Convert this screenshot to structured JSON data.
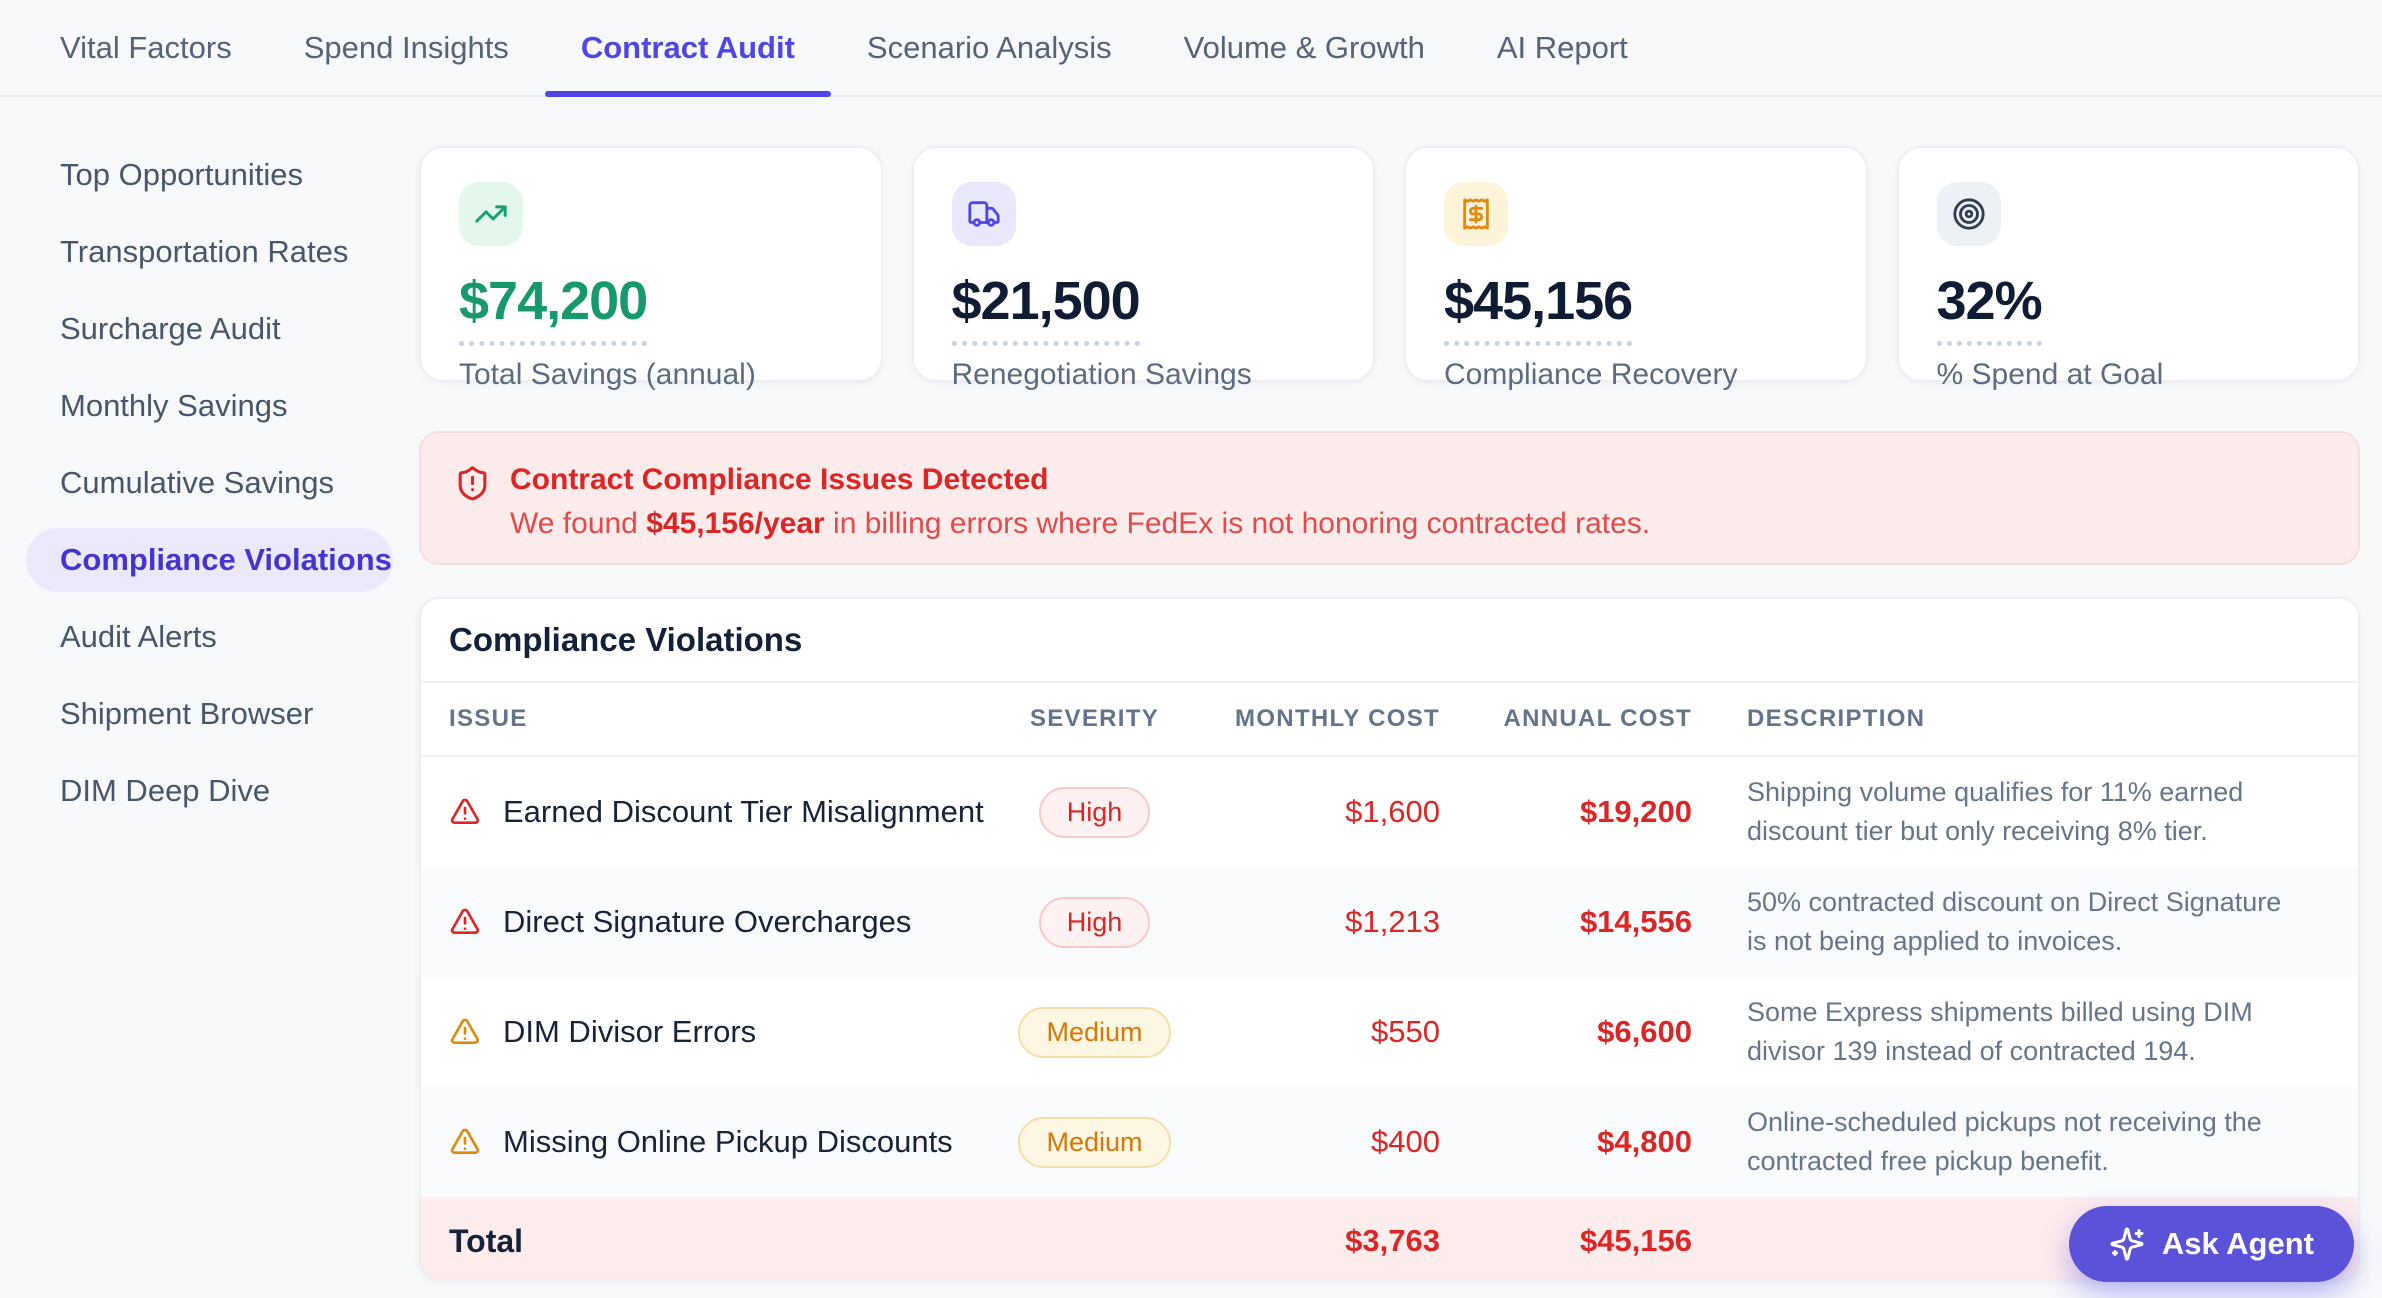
{
  "tabs": {
    "items": [
      {
        "label": "Vital Factors"
      },
      {
        "label": "Spend Insights"
      },
      {
        "label": "Contract Audit"
      },
      {
        "label": "Scenario Analysis"
      },
      {
        "label": "Volume & Growth"
      },
      {
        "label": "AI Report"
      }
    ],
    "active": "Contract Audit"
  },
  "sidebar": {
    "items": [
      {
        "label": "Top Opportunities"
      },
      {
        "label": "Transportation Rates"
      },
      {
        "label": "Surcharge Audit"
      },
      {
        "label": "Monthly Savings"
      },
      {
        "label": "Cumulative Savings"
      },
      {
        "label": "Compliance Violations"
      },
      {
        "label": "Audit Alerts"
      },
      {
        "label": "Shipment Browser"
      },
      {
        "label": "DIM Deep Dive"
      }
    ],
    "active": "Compliance Violations"
  },
  "stats": {
    "cards": [
      {
        "icon": "trending-up-icon",
        "value": "$74,200",
        "label": "Total Savings (annual)",
        "value_color": "#17996c"
      },
      {
        "icon": "truck-icon",
        "value": "$21,500",
        "label": "Renegotiation Savings",
        "value_color": "#101c33"
      },
      {
        "icon": "receipt-icon",
        "value": "$45,156",
        "label": "Compliance Recovery",
        "value_color": "#101c33"
      },
      {
        "icon": "target-icon",
        "value": "32%",
        "label": "% Spend at Goal",
        "value_color": "#101c33"
      }
    ]
  },
  "alert": {
    "title": "Contract Compliance Issues Detected",
    "body_prefix": "We found ",
    "body_highlight": "$45,156/year",
    "body_suffix": " in billing errors where FedEx is not honoring contracted rates."
  },
  "table": {
    "title": "Compliance Violations",
    "columns": {
      "issue": "Issue",
      "severity": "Severity",
      "monthly": "Monthly Cost",
      "annual": "Annual Cost",
      "description": "Description"
    },
    "rows": [
      {
        "issue": "Earned Discount Tier Misalignment",
        "severity": "High",
        "monthly": "$1,600",
        "annual": "$19,200",
        "description": "Shipping volume qualifies for 11% earned discount tier but only receiving 8% tier."
      },
      {
        "issue": "Direct Signature Overcharges",
        "severity": "High",
        "monthly": "$1,213",
        "annual": "$14,556",
        "description": "50% contracted discount on Direct Signature is not being applied to invoices."
      },
      {
        "issue": "DIM Divisor Errors",
        "severity": "Medium",
        "monthly": "$550",
        "annual": "$6,600",
        "description": "Some Express shipments billed using DIM divisor 139 instead of contracted 194."
      },
      {
        "issue": "Missing Online Pickup Discounts",
        "severity": "Medium",
        "monthly": "$400",
        "annual": "$4,800",
        "description": "Online-scheduled pickups not receiving the contracted free pickup benefit."
      }
    ],
    "total": {
      "label": "Total",
      "monthly": "$3,763",
      "annual": "$45,156"
    }
  },
  "ask_agent": {
    "label": "Ask Agent"
  },
  "colors": {
    "accent": "#4f46e5",
    "green": "#17996c",
    "red": "#dc2626",
    "amber": "#d97706",
    "alert_bg": "#fcebeb",
    "active_pill_bg": "#ebe8fb",
    "page_bg": "#f7f8fa"
  }
}
